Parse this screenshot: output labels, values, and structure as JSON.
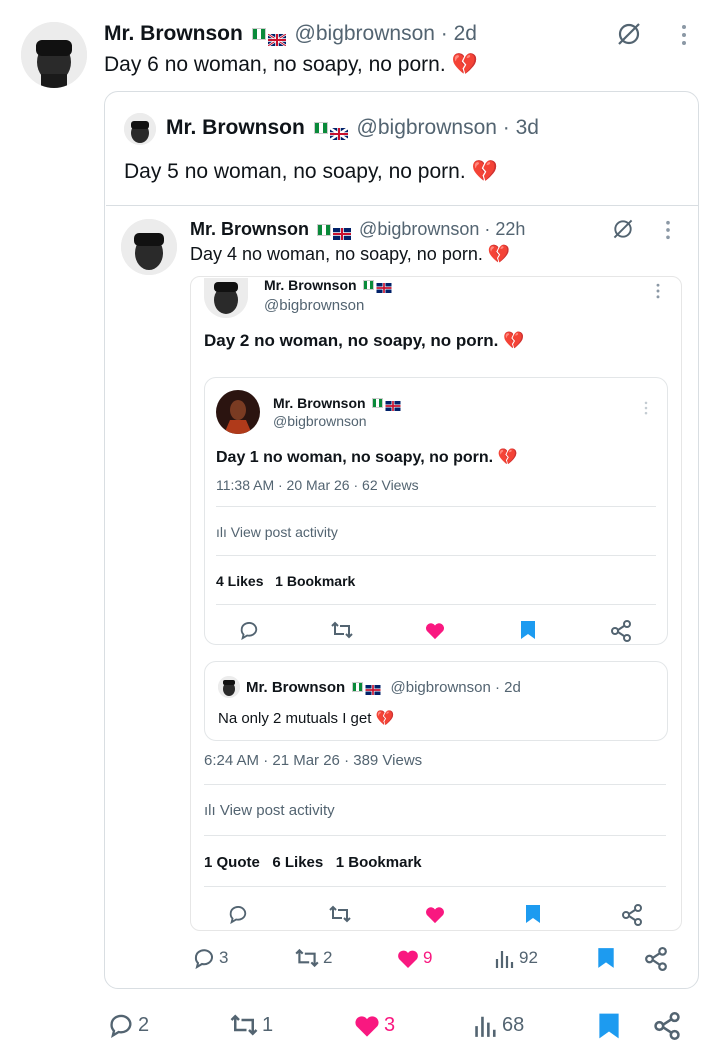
{
  "tweet": {
    "name": "Mr. Brownson",
    "handle": "@bigbrownson",
    "time": "· 2d",
    "text": "Day 6 no woman, no soapy, no porn.",
    "emoji": "💔",
    "stats": {
      "replies": "2",
      "reposts": "1",
      "likes": "3",
      "views": "68"
    }
  },
  "quote1": {
    "name": "Mr. Brownson",
    "handle": "@bigbrownson",
    "time": "· 3d",
    "text": "Day 5 no woman, no soapy, no porn.",
    "emoji": "💔",
    "stats": {
      "replies": "3",
      "reposts": "2",
      "likes": "9",
      "views": "92"
    }
  },
  "quote2": {
    "name": "Mr. Brownson",
    "handle": "@bigbrownson",
    "time": "· 22h",
    "text": "Day 4 no woman, no soapy, no porn.",
    "emoji": "💔"
  },
  "screenshot_post": {
    "name": "Mr. Brownson",
    "handle": "@bigbrownson",
    "text": "Day 2 no woman, no soapy, no porn.",
    "emoji": "💔",
    "meta": "6:24 AM · 21 Mar 26 · 389 Views",
    "activity": "View post activity",
    "counts": {
      "quote": "1 Quote",
      "likes": "6 Likes",
      "bookmark": "1 Bookmark"
    }
  },
  "inner_post": {
    "name": "Mr. Brownson",
    "handle": "@bigbrownson",
    "text": "Day 1 no woman, no soapy, no porn.",
    "emoji": "💔",
    "meta": "11:38 AM · 20 Mar 26 · 62 Views",
    "activity": "View post activity",
    "counts": {
      "likes": "4 Likes",
      "bookmark": "1 Bookmark"
    }
  },
  "reply_quote": {
    "name": "Mr. Brownson",
    "handle": "@bigbrownson",
    "time": "· 2d",
    "text": "Na only 2 mutuals I get",
    "emoji": "💔"
  },
  "colors": {
    "like": "#f91880",
    "bookmark": "#1d9bf0",
    "muted": "#536471"
  }
}
